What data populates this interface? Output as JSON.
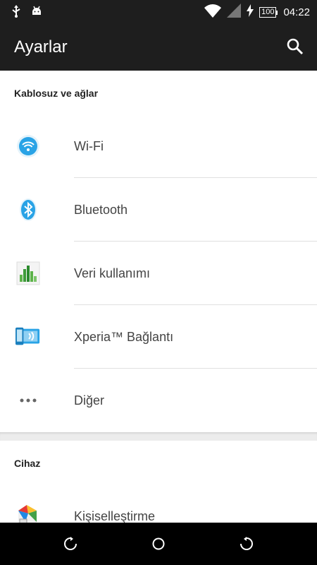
{
  "status_bar": {
    "time": "04:22",
    "battery": "100",
    "left_icons": [
      "usb-icon",
      "android-debug-icon"
    ],
    "right_icons": [
      "wifi-signal-icon",
      "cell-signal-icon",
      "charging-icon"
    ]
  },
  "app_bar": {
    "title": "Ayarlar",
    "search_icon": "search-icon"
  },
  "sections": [
    {
      "header": "Kablosuz ve ağlar",
      "items": [
        {
          "label": "Wi-Fi",
          "icon": "wifi-icon"
        },
        {
          "label": "Bluetooth",
          "icon": "bluetooth-icon"
        },
        {
          "label": "Veri kullanımı",
          "icon": "data-usage-icon"
        },
        {
          "label": "Xperia™ Bağlantı",
          "icon": "xperia-connectivity-icon"
        },
        {
          "label": "Diğer",
          "icon": "more-icon"
        }
      ]
    },
    {
      "header": "Cihaz",
      "items": [
        {
          "label": "Kişiselleştirme",
          "icon": "personalization-icon"
        }
      ]
    }
  ],
  "nav_bar": {
    "buttons": [
      "back-button",
      "home-button",
      "recents-button"
    ]
  },
  "colors": {
    "bar_background": "#1e1e1e",
    "accent_blue": "#29a3e6"
  }
}
